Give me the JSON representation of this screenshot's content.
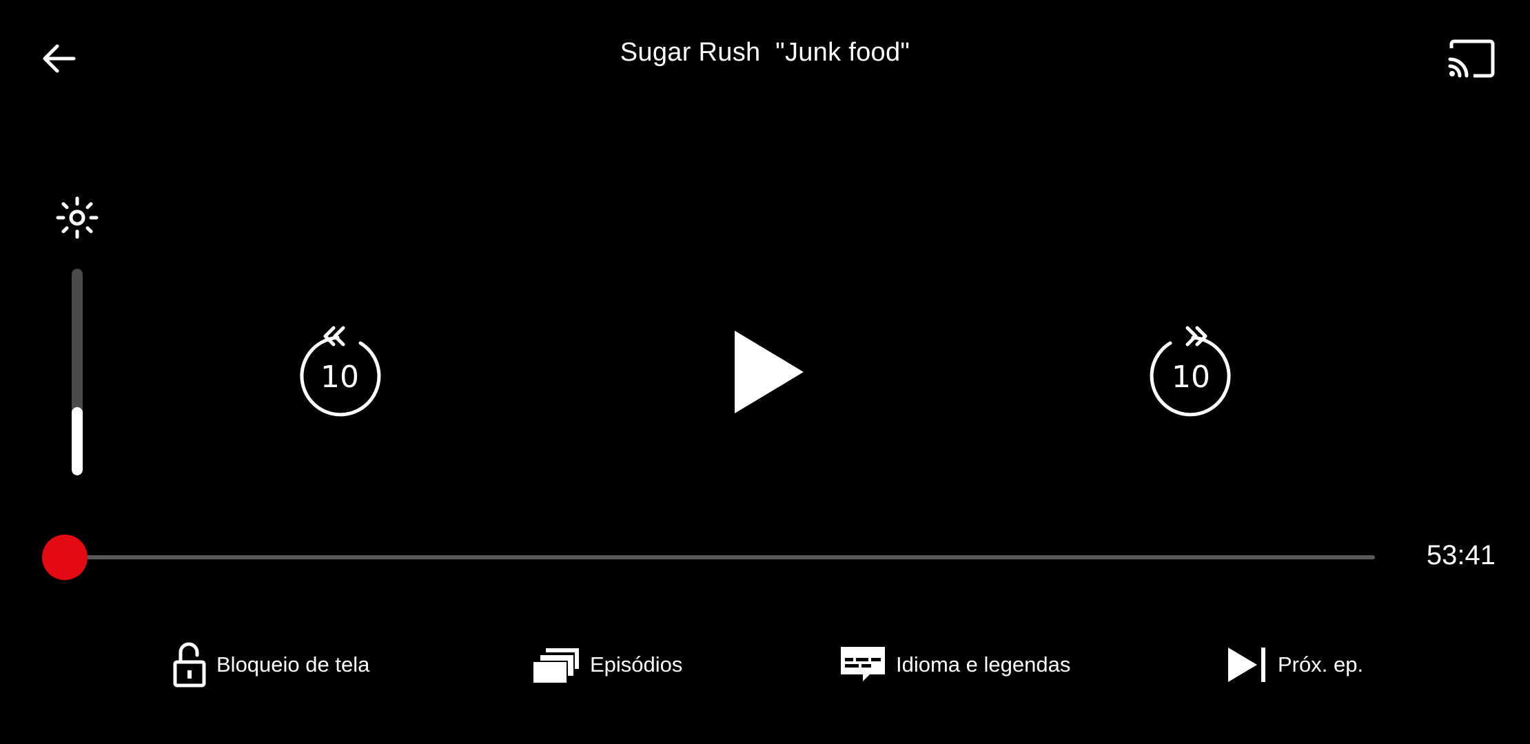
{
  "header": {
    "title": "Sugar Rush  \"Junk food\"",
    "back_icon": "arrow-left-icon",
    "cast_icon": "cast-icon"
  },
  "brightness": {
    "icon": "brightness-icon",
    "level": 0.33
  },
  "controls": {
    "rewind_label": "10",
    "forward_label": "10",
    "play_icon": "play-icon"
  },
  "progress": {
    "position": 0.0,
    "time_remaining": "53:41",
    "accent_color": "#e50914"
  },
  "bottom_bar": {
    "lock_label": "Bloqueio de tela",
    "episodes_label": "Episódios",
    "subtitles_label": "Idioma e legendas",
    "next_label": "Próx. ep."
  }
}
